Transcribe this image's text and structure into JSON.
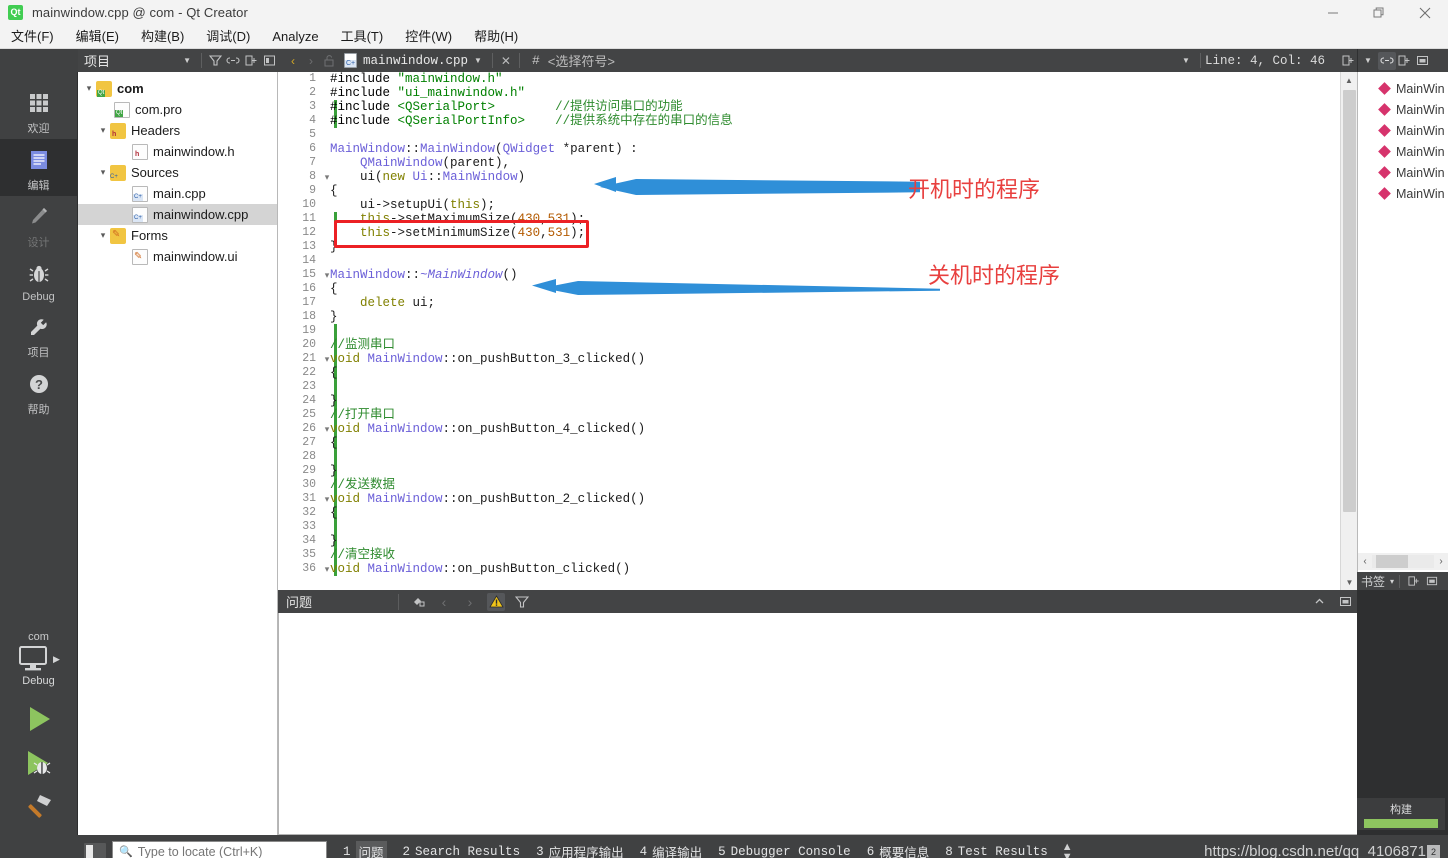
{
  "window": {
    "title": "mainwindow.cpp @ com - Qt Creator",
    "logo": "qt-logo",
    "minimize": "−",
    "maximize": "❐",
    "close": "✕"
  },
  "menubar": {
    "items": [
      {
        "label": "文件(F)",
        "name": "menu-file"
      },
      {
        "label": "编辑(E)",
        "name": "menu-edit"
      },
      {
        "label": "构建(B)",
        "name": "menu-build"
      },
      {
        "label": "调试(D)",
        "name": "menu-debug"
      },
      {
        "label": "Analyze",
        "name": "menu-analyze"
      },
      {
        "label": "工具(T)",
        "name": "menu-tools"
      },
      {
        "label": "控件(W)",
        "name": "menu-window"
      },
      {
        "label": "帮助(H)",
        "name": "menu-help"
      }
    ]
  },
  "toolbar": {
    "project_selector": "项目",
    "filter_icon": "filter-icon",
    "link_icon": "link-icon",
    "split_icon": "split-icon",
    "fullscreen_icon": "maximize-pane-icon",
    "nav_back": "‹",
    "nav_forward": "›",
    "lock_icon": "unlocked-icon",
    "open_file": "mainwindow.cpp",
    "close_file_icon": "✕",
    "symbol_hash": "#",
    "symbol_placeholder": "<选择符号>",
    "line_col": "Line: 4, Col: 46",
    "split_editor_icon": "split-editor-icon",
    "link_editors_icon": "link-editors-icon",
    "add_split_icon": "add-split-icon",
    "close_split_icon": "close-split-icon"
  },
  "activitybar": {
    "items": [
      {
        "label": "欢迎",
        "icon": "grid-icon",
        "selected": false,
        "disabled": false
      },
      {
        "label": "编辑",
        "icon": "document-lines-icon",
        "selected": true,
        "disabled": false
      },
      {
        "label": "设计",
        "icon": "pencil-icon",
        "selected": false,
        "disabled": true
      },
      {
        "label": "Debug",
        "icon": "bug-icon",
        "selected": false,
        "disabled": false
      },
      {
        "label": "项目",
        "icon": "wrench-icon",
        "selected": false,
        "disabled": false
      },
      {
        "label": "帮助",
        "icon": "question-icon",
        "selected": false,
        "disabled": false
      }
    ],
    "kit_name": "com",
    "kit_config": "Debug",
    "kit_icon": "monitor-icon",
    "run_icon": "run-green-triangle",
    "debug_icon": "debug-run-icon",
    "build_icon": "hammer-icon"
  },
  "project_tree": {
    "nodes": [
      {
        "label": "com",
        "indent": 0,
        "arrow": "▾",
        "icon": "qt-project-folder-icon",
        "bold": true,
        "selected": false
      },
      {
        "label": "com.pro",
        "indent": 1,
        "arrow": "",
        "icon": "qt-pro-file-icon",
        "bold": false,
        "selected": false
      },
      {
        "label": "Headers",
        "indent": 1,
        "arrow": "▾",
        "icon": "headers-folder-icon",
        "bold": false,
        "selected": false
      },
      {
        "label": "mainwindow.h",
        "indent": 2,
        "arrow": "",
        "icon": "header-file-icon",
        "bold": false,
        "selected": false
      },
      {
        "label": "Sources",
        "indent": 1,
        "arrow": "▾",
        "icon": "sources-folder-icon",
        "bold": false,
        "selected": false
      },
      {
        "label": "main.cpp",
        "indent": 2,
        "arrow": "",
        "icon": "cpp-file-icon",
        "bold": false,
        "selected": false
      },
      {
        "label": "mainwindow.cpp",
        "indent": 2,
        "arrow": "",
        "icon": "cpp-file-icon",
        "bold": false,
        "selected": true
      },
      {
        "label": "Forms",
        "indent": 1,
        "arrow": "▾",
        "icon": "forms-folder-icon",
        "bold": false,
        "selected": false
      },
      {
        "label": "mainwindow.ui",
        "indent": 2,
        "arrow": "",
        "icon": "ui-file-icon",
        "bold": false,
        "selected": false
      }
    ]
  },
  "editor": {
    "first_line": 1,
    "lines": [
      {
        "n": 1,
        "fold": "",
        "change": false,
        "tokens": [
          {
            "t": "#include ",
            "c": "pp"
          },
          {
            "t": "\"mainwindow.h\"",
            "c": "str"
          }
        ]
      },
      {
        "n": 2,
        "fold": "",
        "change": false,
        "tokens": [
          {
            "t": "#include ",
            "c": "pp"
          },
          {
            "t": "\"ui_mainwindow.h\"",
            "c": "str"
          }
        ]
      },
      {
        "n": 3,
        "fold": "",
        "change": true,
        "tokens": [
          {
            "t": "#include ",
            "c": "pp"
          },
          {
            "t": "<QSerialPort>",
            "c": "str"
          },
          {
            "t": "        ",
            "c": "plain"
          },
          {
            "t": "//提供访问串口的功能",
            "c": "cmt"
          }
        ]
      },
      {
        "n": 4,
        "fold": "",
        "change": true,
        "tokens": [
          {
            "t": "#include ",
            "c": "pp"
          },
          {
            "t": "<QSerialPortInfo>",
            "c": "str"
          },
          {
            "t": "    ",
            "c": "plain"
          },
          {
            "t": "//提供系统中存在的串口的信息",
            "c": "cmt"
          }
        ]
      },
      {
        "n": 5,
        "fold": "",
        "change": false,
        "tokens": []
      },
      {
        "n": 6,
        "fold": "",
        "change": false,
        "tokens": [
          {
            "t": "MainWindow",
            "c": "typ"
          },
          {
            "t": "::",
            "c": "plain"
          },
          {
            "t": "MainWindow",
            "c": "typ"
          },
          {
            "t": "(",
            "c": "plain"
          },
          {
            "t": "QWidget",
            "c": "typ"
          },
          {
            "t": " *parent) :",
            "c": "plain"
          }
        ]
      },
      {
        "n": 7,
        "fold": "",
        "change": false,
        "tokens": [
          {
            "t": "    ",
            "c": "plain"
          },
          {
            "t": "QMainWindow",
            "c": "typ"
          },
          {
            "t": "(parent),",
            "c": "plain"
          }
        ]
      },
      {
        "n": 8,
        "fold": "▾",
        "change": false,
        "tokens": [
          {
            "t": "    ui(",
            "c": "plain"
          },
          {
            "t": "new",
            "c": "kw"
          },
          {
            "t": " ",
            "c": "plain"
          },
          {
            "t": "Ui",
            "c": "typ"
          },
          {
            "t": "::",
            "c": "plain"
          },
          {
            "t": "MainWindow",
            "c": "typ"
          },
          {
            "t": ")",
            "c": "plain"
          }
        ]
      },
      {
        "n": 9,
        "fold": "",
        "change": false,
        "tokens": [
          {
            "t": "{",
            "c": "plain"
          }
        ]
      },
      {
        "n": 10,
        "fold": "",
        "change": false,
        "tokens": [
          {
            "t": "    ui->setupUi(",
            "c": "plain"
          },
          {
            "t": "this",
            "c": "kw"
          },
          {
            "t": ");",
            "c": "plain"
          }
        ]
      },
      {
        "n": 11,
        "fold": "",
        "change": true,
        "tokens": [
          {
            "t": "    ",
            "c": "plain"
          },
          {
            "t": "this",
            "c": "kw"
          },
          {
            "t": "->setMaximumSize(",
            "c": "plain"
          },
          {
            "t": "430",
            "c": "num"
          },
          {
            "t": ",",
            "c": "plain"
          },
          {
            "t": "531",
            "c": "num"
          },
          {
            "t": ");",
            "c": "plain"
          }
        ]
      },
      {
        "n": 12,
        "fold": "",
        "change": true,
        "tokens": [
          {
            "t": "    ",
            "c": "plain"
          },
          {
            "t": "this",
            "c": "kw"
          },
          {
            "t": "->setMinimumSize(",
            "c": "plain"
          },
          {
            "t": "430",
            "c": "num"
          },
          {
            "t": ",",
            "c": "plain"
          },
          {
            "t": "531",
            "c": "num"
          },
          {
            "t": ");",
            "c": "plain"
          }
        ]
      },
      {
        "n": 13,
        "fold": "",
        "change": false,
        "tokens": [
          {
            "t": "}",
            "c": "plain"
          }
        ]
      },
      {
        "n": 14,
        "fold": "",
        "change": false,
        "tokens": []
      },
      {
        "n": 15,
        "fold": "▾",
        "change": false,
        "tokens": [
          {
            "t": "MainWindow",
            "c": "typ"
          },
          {
            "t": "::",
            "c": "plain"
          },
          {
            "t": "~MainWindow",
            "c": "typ ital"
          },
          {
            "t": "()",
            "c": "plain"
          }
        ]
      },
      {
        "n": 16,
        "fold": "",
        "change": false,
        "tokens": [
          {
            "t": "{",
            "c": "plain"
          }
        ]
      },
      {
        "n": 17,
        "fold": "",
        "change": false,
        "tokens": [
          {
            "t": "    ",
            "c": "plain"
          },
          {
            "t": "delete",
            "c": "kw"
          },
          {
            "t": " ui;",
            "c": "plain"
          }
        ]
      },
      {
        "n": 18,
        "fold": "",
        "change": false,
        "tokens": [
          {
            "t": "}",
            "c": "plain"
          }
        ]
      },
      {
        "n": 19,
        "fold": "",
        "change": true,
        "tokens": []
      },
      {
        "n": 20,
        "fold": "",
        "change": true,
        "tokens": [
          {
            "t": "//监测串口",
            "c": "cmt"
          }
        ]
      },
      {
        "n": 21,
        "fold": "▾",
        "change": true,
        "tokens": [
          {
            "t": "void",
            "c": "kw"
          },
          {
            "t": " ",
            "c": "plain"
          },
          {
            "t": "MainWindow",
            "c": "typ"
          },
          {
            "t": "::on_pushButton_3_clicked()",
            "c": "plain"
          }
        ]
      },
      {
        "n": 22,
        "fold": "",
        "change": true,
        "tokens": [
          {
            "t": "{",
            "c": "plain"
          }
        ]
      },
      {
        "n": 23,
        "fold": "",
        "change": true,
        "tokens": []
      },
      {
        "n": 24,
        "fold": "",
        "change": true,
        "tokens": [
          {
            "t": "}",
            "c": "plain"
          }
        ]
      },
      {
        "n": 25,
        "fold": "",
        "change": true,
        "tokens": [
          {
            "t": "//打开串口",
            "c": "cmt"
          }
        ]
      },
      {
        "n": 26,
        "fold": "▾",
        "change": true,
        "tokens": [
          {
            "t": "void",
            "c": "kw"
          },
          {
            "t": " ",
            "c": "plain"
          },
          {
            "t": "MainWindow",
            "c": "typ"
          },
          {
            "t": "::on_pushButton_4_clicked()",
            "c": "plain"
          }
        ]
      },
      {
        "n": 27,
        "fold": "",
        "change": true,
        "tokens": [
          {
            "t": "{",
            "c": "plain"
          }
        ]
      },
      {
        "n": 28,
        "fold": "",
        "change": true,
        "tokens": []
      },
      {
        "n": 29,
        "fold": "",
        "change": true,
        "tokens": [
          {
            "t": "}",
            "c": "plain"
          }
        ]
      },
      {
        "n": 30,
        "fold": "",
        "change": true,
        "tokens": [
          {
            "t": "//发送数据",
            "c": "cmt"
          }
        ]
      },
      {
        "n": 31,
        "fold": "▾",
        "change": true,
        "tokens": [
          {
            "t": "void",
            "c": "kw"
          },
          {
            "t": " ",
            "c": "plain"
          },
          {
            "t": "MainWindow",
            "c": "typ"
          },
          {
            "t": "::on_pushButton_2_clicked()",
            "c": "plain"
          }
        ]
      },
      {
        "n": 32,
        "fold": "",
        "change": true,
        "tokens": [
          {
            "t": "{",
            "c": "plain"
          }
        ]
      },
      {
        "n": 33,
        "fold": "",
        "change": true,
        "tokens": []
      },
      {
        "n": 34,
        "fold": "",
        "change": true,
        "tokens": [
          {
            "t": "}",
            "c": "plain"
          }
        ]
      },
      {
        "n": 35,
        "fold": "",
        "change": true,
        "tokens": [
          {
            "t": "//清空接收",
            "c": "cmt"
          }
        ]
      },
      {
        "n": 36,
        "fold": "▾",
        "change": true,
        "tokens": [
          {
            "t": "void",
            "c": "kw"
          },
          {
            "t": " ",
            "c": "plain"
          },
          {
            "t": "MainWindow",
            "c": "typ"
          },
          {
            "t": "::on_pushButton_clicked()",
            "c": "plain"
          }
        ]
      }
    ]
  },
  "annotations": {
    "highlight_color": "#ec2024",
    "arrow_color": "#2f8fd8",
    "text_color": "#e8403f",
    "items": [
      {
        "text": "开机时的程序",
        "name": "annotation-startup"
      },
      {
        "text": "关机时的程序",
        "name": "annotation-shutdown"
      }
    ]
  },
  "outline": {
    "items": [
      {
        "label": "MainWin"
      },
      {
        "label": "MainWin"
      },
      {
        "label": "MainWin"
      },
      {
        "label": "MainWin"
      },
      {
        "label": "MainWin"
      },
      {
        "label": "MainWin"
      }
    ],
    "footer_label": "书签",
    "footer_caret": "▾",
    "footer_split_icon": "split-icon",
    "footer_close_icon": "close-pane-icon"
  },
  "problems_panel": {
    "title": "问题",
    "filter_icon": "clean-icon",
    "prev_icon": "‹",
    "next_icon": "›",
    "warning_icon": "warning-triangle-icon",
    "funnel_icon": "funnel-icon",
    "collapse_icon": "⌃",
    "maximize_icon": "maximize-pane-icon"
  },
  "build_progress": {
    "label": "构建",
    "bar_color": "#8dc45f",
    "percent": 100
  },
  "statusbar": {
    "sidebar_toggle_icon": "sidebar-toggle-icon",
    "locator_icon": "search-icon",
    "locator_placeholder": "Type to locate (Ctrl+K)",
    "locator_value": "",
    "output_panes": [
      {
        "num": "1",
        "label": "问题",
        "selected": true
      },
      {
        "num": "2",
        "label": "Search Results",
        "selected": false
      },
      {
        "num": "3",
        "label": "应用程序输出",
        "selected": false
      },
      {
        "num": "4",
        "label": "编译输出",
        "selected": false
      },
      {
        "num": "5",
        "label": "Debugger Console",
        "selected": false
      },
      {
        "num": "6",
        "label": "概要信息",
        "selected": false
      },
      {
        "num": "8",
        "label": "Test Results",
        "selected": false
      }
    ],
    "updown_icon": "⇕",
    "watermark": "https://blog.csdn.net/qq_4106871",
    "watermark_badge": "2"
  }
}
